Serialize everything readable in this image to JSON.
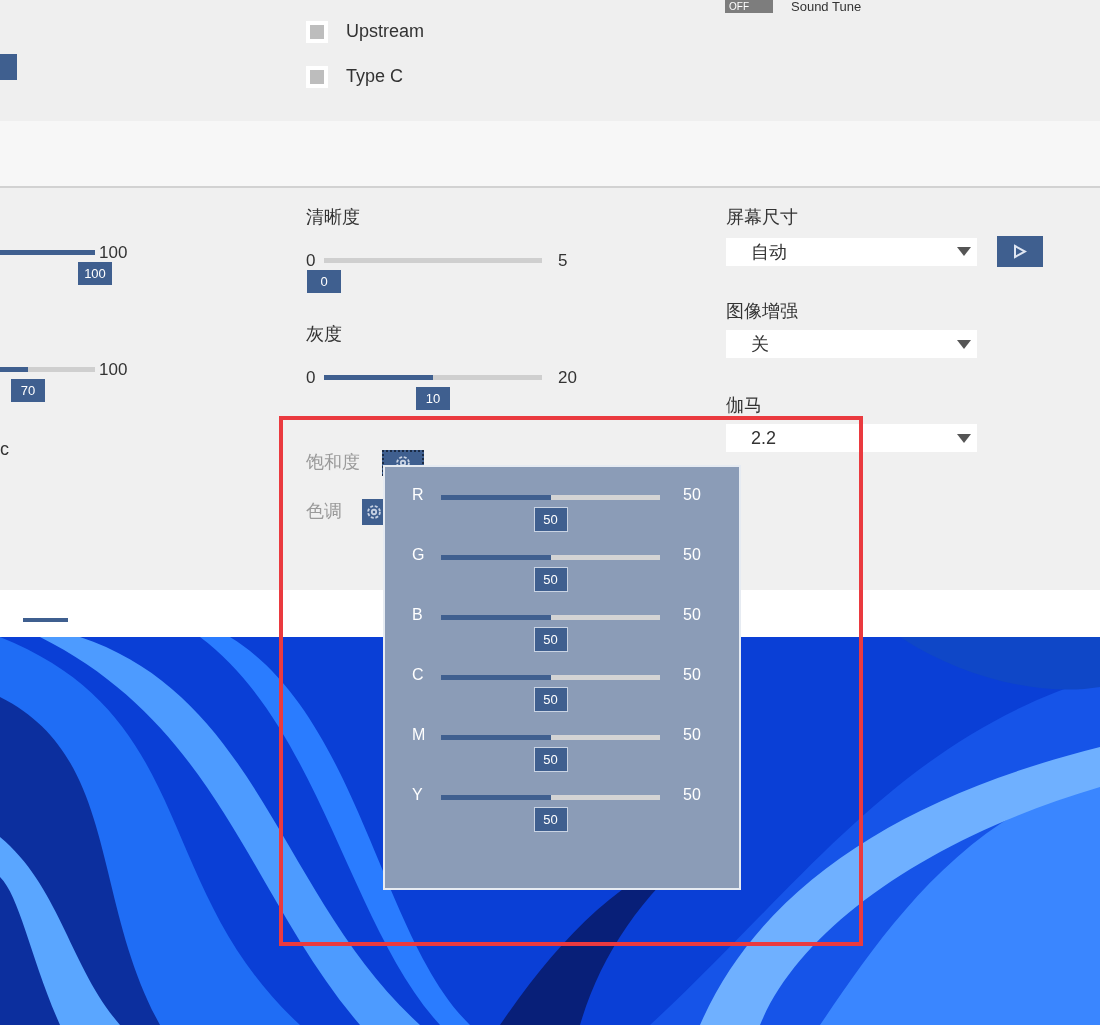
{
  "top_panel": {
    "toggle": {
      "state_label": "OFF",
      "label": "Sound Tune",
      "on": false
    },
    "checkboxes": [
      {
        "label": "Upstream",
        "checked": false
      },
      {
        "label": "Type C",
        "checked": false
      }
    ]
  },
  "left_sliders": [
    {
      "max_label": "100",
      "value": "100",
      "level": 1
    },
    {
      "max_label": "100",
      "value": "70",
      "level": 0.7
    }
  ],
  "left_fragment": "c",
  "middle_sliders": [
    {
      "title": "清晰度",
      "min_label": "0",
      "max_label": "5",
      "value": "0",
      "level": 0
    },
    {
      "title": "灰度",
      "min_label": "0",
      "max_label": "20",
      "value": "10",
      "level": 0.5
    }
  ],
  "color_rows": [
    {
      "label": "饱和度",
      "expanded": true
    },
    {
      "label": "色调",
      "expanded": false
    }
  ],
  "dropdowns": [
    {
      "title": "屏幕尺寸",
      "value": "自动",
      "action_button": true
    },
    {
      "title": "图像增强",
      "value": "关",
      "action_button": false
    },
    {
      "title": "伽马",
      "value": "2.2",
      "action_button": false
    }
  ],
  "popup": {
    "channels": [
      {
        "label": "R",
        "value": "50",
        "reading": "50",
        "level": 0.5
      },
      {
        "label": "G",
        "value": "50",
        "reading": "50",
        "level": 0.5
      },
      {
        "label": "B",
        "value": "50",
        "reading": "50",
        "level": 0.5
      },
      {
        "label": "C",
        "value": "50",
        "reading": "50",
        "level": 0.5
      },
      {
        "label": "M",
        "value": "50",
        "reading": "50",
        "level": 0.5
      },
      {
        "label": "Y",
        "value": "50",
        "reading": "50",
        "level": 0.5
      }
    ]
  }
}
